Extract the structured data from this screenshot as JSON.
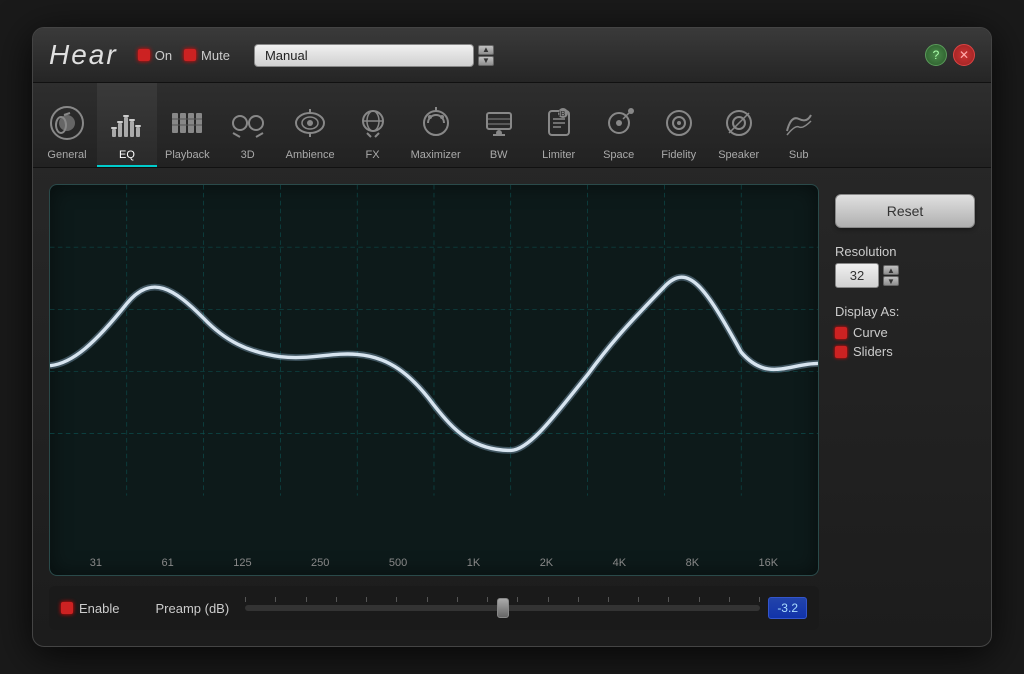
{
  "app": {
    "title": "Hear"
  },
  "header": {
    "on_label": "On",
    "mute_label": "Mute",
    "preset_value": "Manual",
    "help_icon": "?",
    "close_icon": "✕"
  },
  "tabs": [
    {
      "id": "general",
      "label": "General",
      "active": false
    },
    {
      "id": "eq",
      "label": "EQ",
      "active": true
    },
    {
      "id": "playback",
      "label": "Playback",
      "active": false
    },
    {
      "id": "3d",
      "label": "3D",
      "active": false
    },
    {
      "id": "ambience",
      "label": "Ambience",
      "active": false
    },
    {
      "id": "fx",
      "label": "FX",
      "active": false
    },
    {
      "id": "maximizer",
      "label": "Maximizer",
      "active": false
    },
    {
      "id": "bw",
      "label": "BW",
      "active": false
    },
    {
      "id": "limiter",
      "label": "Limiter",
      "active": false
    },
    {
      "id": "space",
      "label": "Space",
      "active": false
    },
    {
      "id": "fidelity",
      "label": "Fidelity",
      "active": false
    },
    {
      "id": "speaker",
      "label": "Speaker",
      "active": false
    },
    {
      "id": "sub",
      "label": "Sub",
      "active": false
    }
  ],
  "eq": {
    "freq_labels": [
      "31",
      "61",
      "125",
      "250",
      "500",
      "1K",
      "2K",
      "4K",
      "8K",
      "16K"
    ]
  },
  "bottom_bar": {
    "enable_label": "Enable",
    "preamp_label": "Preamp (dB)",
    "preamp_value": "-3.2"
  },
  "right_panel": {
    "reset_label": "Reset",
    "resolution_label": "Resolution",
    "resolution_value": "32",
    "display_as_label": "Display As:",
    "curve_label": "Curve",
    "sliders_label": "Sliders"
  }
}
